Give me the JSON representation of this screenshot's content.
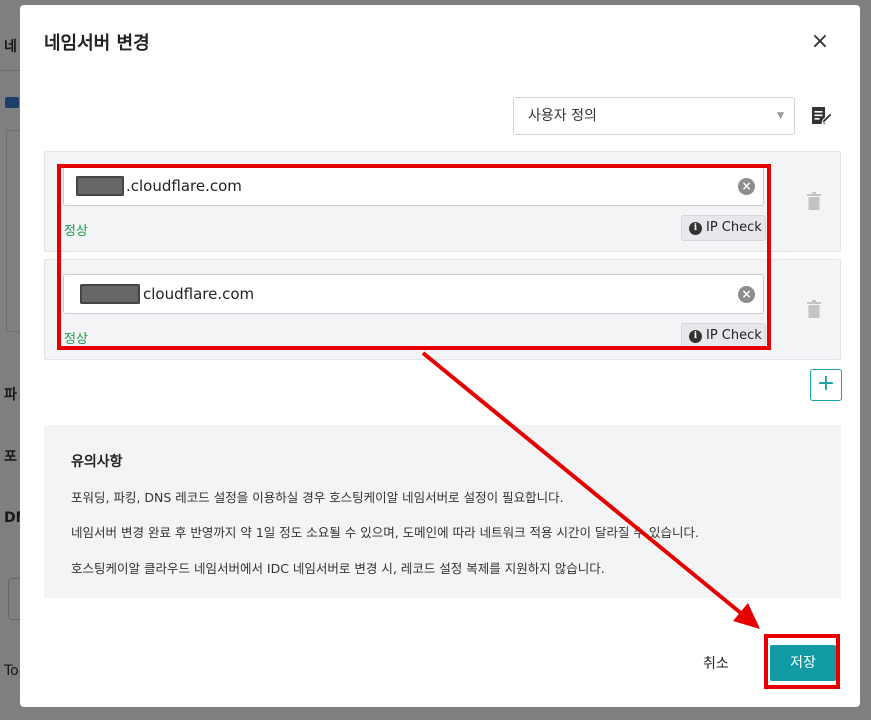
{
  "modal": {
    "title": "네임서버 변경",
    "close_label": "×"
  },
  "nameserver_type": {
    "selected": "사용자 정의"
  },
  "nameservers": [
    {
      "value_suffix": ".cloudflare.com",
      "status": "정상",
      "ip_check_label": "IP Check"
    },
    {
      "value_suffix": "cloudflare.com",
      "status": "정상",
      "ip_check_label": "IP Check"
    }
  ],
  "add_button_label": "+",
  "notice": {
    "title": "유의사항",
    "lines": [
      "포워딩, 파킹, DNS 레코드 설정을 이용하실 경우 호스팅케이알 네임서버로 설정이 필요합니다.",
      "네임서버 변경 완료 후 반영까지 약 1일 정도 소요될 수 있으며, 도메인에 따라 네트워크 적용 시간이 달라질 수 있습니다.",
      "호스팅케이알 클라우드 네임서버에서 IDC 네임서버로 변경 시, 레코드 설정 복제를 지원하지 않습니다."
    ]
  },
  "footer": {
    "cancel_label": "취소",
    "save_label": "저장"
  },
  "background": {
    "fragments": [
      "네",
      "파",
      "포",
      "DN",
      "To"
    ]
  },
  "colors": {
    "accent": "#139ba3",
    "status_ok": "#1a9c4a",
    "annotation": "#e60000"
  }
}
